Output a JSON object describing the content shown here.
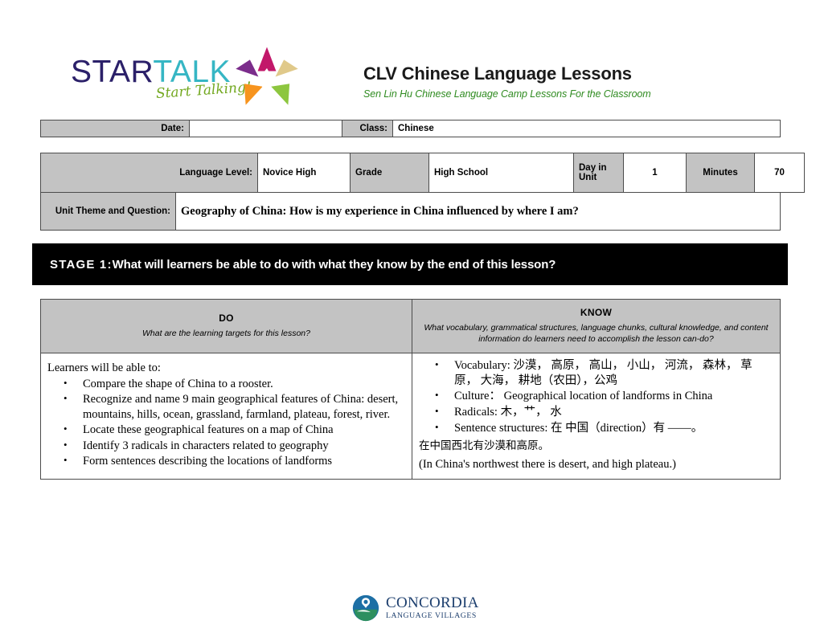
{
  "header": {
    "logo": {
      "brand_part1": "STAR",
      "brand_part2": "TALK",
      "brand_color1": "#2b2069",
      "brand_color2": "#36b6c4",
      "tagline": "Start Talking!",
      "tagline_color": "#73a820",
      "star_colors": [
        "#c2186a",
        "#e0c98a",
        "#8dc63f",
        "#f7941e",
        "#7b2d8b"
      ]
    },
    "title": "CLV Chinese Language Lessons",
    "subtitle": "Sen Lin Hu Chinese Language Camp Lessons For the Classroom",
    "subtitle_color": "#2f8b20"
  },
  "date_row": {
    "date_label": "Date:",
    "date_value": "",
    "class_label": "Class:",
    "class_value": "Chinese"
  },
  "meta_row": {
    "language_level_label": "Language Level:",
    "language_level_value": "Novice High",
    "grade_label": "Grade",
    "grade_value": "High School",
    "day_in_unit_label": "Day in Unit",
    "day_in_unit_value": "1",
    "minutes_label": "Minutes",
    "minutes_value": "70"
  },
  "theme_row": {
    "label": "Unit Theme and Question:",
    "value": "Geography of China:  How is my experience in China influenced by where I am?"
  },
  "stage": {
    "number": "STAGE 1:",
    "question": "What will learners be able to do with what they know by the end of this lesson?",
    "background": "#000000",
    "text_color": "#ffffff"
  },
  "do_column": {
    "title": "DO",
    "subtitle": "What are the learning targets for this lesson?",
    "lead": "Learners will be able to:",
    "bullets": [
      "Compare the shape of China to a rooster.",
      "Recognize and name 9 main geographical features of China: desert, mountains, hills, ocean, grassland, farmland, plateau, forest, river.",
      "Locate these geographical features on a map of China",
      "Identify 3 radicals in characters related to geography",
      "Form sentences describing the locations of landforms"
    ]
  },
  "know_column": {
    "title": "KNOW",
    "subtitle": "What vocabulary, grammatical structures, language chunks, cultural knowledge, and content information do learners need to accomplish the lesson can-do?",
    "bullets": [
      "Vocabulary: 沙漠，  高原，  高山，  小山，  河流，  森林，  草原，  大海，  耕地（农田），公鸡",
      "Culture：   Geographical location of landforms in China",
      "Radicals: 木，艹，  水",
      "Sentence structures:  在 中国（direction）有 ——。"
    ],
    "example_chinese": "在中国西北有沙漠和高原。",
    "example_english": "(In China's northwest there is desert, and high plateau.)"
  },
  "footer": {
    "org_name": "CONCORDIA",
    "org_sub": "LANGUAGE VILLAGES",
    "org_color": "#1d3f6e"
  },
  "theme_colors": {
    "header_cell_gray": "#c3c3c3",
    "border": "#4c4c4c"
  }
}
